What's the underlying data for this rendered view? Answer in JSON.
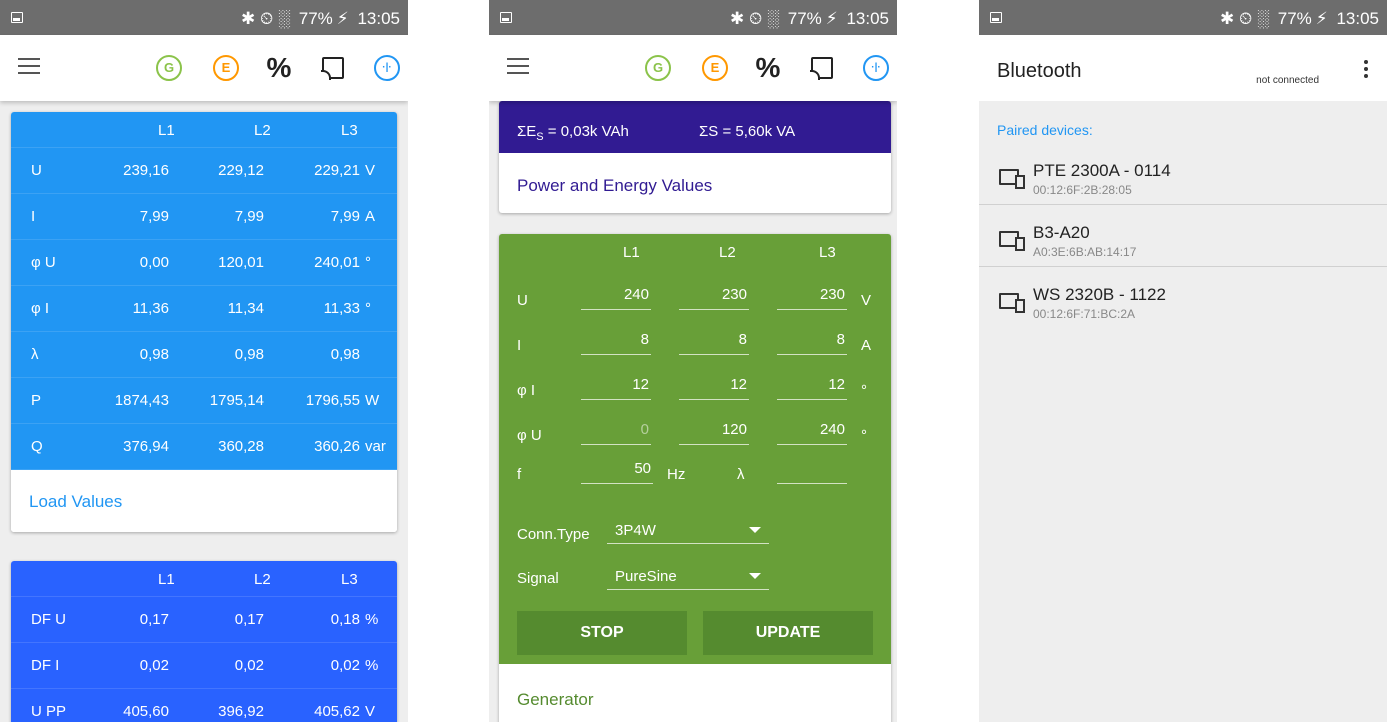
{
  "status_bar": {
    "icons": "✱ ⏲ ░",
    "battery": "77%",
    "battery_icon": "⚡",
    "time": "13:05"
  },
  "toolbar": {
    "icons": {
      "generator": "G",
      "energy": "E",
      "percent": "%",
      "cast": "cast-icon",
      "bluetooth": "·|·"
    }
  },
  "screen1": {
    "load": {
      "headers": [
        "L1",
        "L2",
        "L3"
      ],
      "rows": [
        {
          "name": "U",
          "v1": "239,16",
          "v2": "229,12",
          "v3": "229,21",
          "unit": "V"
        },
        {
          "name": "I",
          "v1": "7,99",
          "v2": "7,99",
          "v3": "7,99",
          "unit": "A"
        },
        {
          "name": "φ U",
          "v1": "0,00",
          "v2": "120,01",
          "v3": "240,01",
          "unit": "°"
        },
        {
          "name": "φ I",
          "v1": "11,36",
          "v2": "11,34",
          "v3": "11,33",
          "unit": "°"
        },
        {
          "name": "λ",
          "v1": "0,98",
          "v2": "0,98",
          "v3": "0,98",
          "unit": ""
        },
        {
          "name": "P",
          "v1": "1874,43",
          "v2": "1795,14",
          "v3": "1796,55",
          "unit": "W"
        },
        {
          "name": "Q",
          "v1": "376,94",
          "v2": "360,28",
          "v3": "360,26",
          "unit": "var"
        }
      ],
      "footer": "Load Values",
      "color": "#2196f3"
    },
    "harmonics": {
      "headers": [
        "L1",
        "L2",
        "L3"
      ],
      "rows": [
        {
          "name": "DF U",
          "v1": "0,17",
          "v2": "0,17",
          "v3": "0,18",
          "unit": "%"
        },
        {
          "name": "DF I",
          "v1": "0,02",
          "v2": "0,02",
          "v3": "0,02",
          "unit": "%"
        },
        {
          "name": "U PP",
          "v1": "405,60",
          "v2": "396,92",
          "v3": "405,62",
          "unit": "V"
        }
      ],
      "color": "#2962ff"
    }
  },
  "screen2": {
    "energy_es": "ΣE",
    "energy_es_sub": "S",
    "energy_es_value": " = 0,03k VAh",
    "power_s": "ΣS = 5,60k VA",
    "power_footer": "Power and Energy Values",
    "generator": {
      "headers": [
        "L1",
        "L2",
        "L3"
      ],
      "rows": [
        {
          "name": "U",
          "v1": "240",
          "v2": "230",
          "v3": "230",
          "unit": "V",
          "dim1": false
        },
        {
          "name": "I",
          "v1": "8",
          "v2": "8",
          "v3": "8",
          "unit": "A",
          "dim1": false
        },
        {
          "name": "φ I",
          "v1": "12",
          "v2": "12",
          "v3": "12",
          "unit": "°",
          "dim1": false
        },
        {
          "name": "φ U",
          "v1": "0",
          "v2": "120",
          "v3": "240",
          "unit": "°",
          "dim1": true
        }
      ],
      "f_label": "f",
      "f_value": "50",
      "f_unit": "Hz",
      "lambda_label": "λ",
      "lambda_value": "",
      "conn_label": "Conn.Type",
      "conn_value": "3P4W",
      "signal_label": "Signal",
      "signal_value": "PureSine",
      "stop_label": "STOP",
      "update_label": "UPDATE",
      "footer": "Generator"
    }
  },
  "screen3": {
    "title": "Bluetooth",
    "status": "not connected",
    "paired_label": "Paired devices:",
    "devices": [
      {
        "name": "PTE 2300A - 0114",
        "address": "00:12:6F:2B:28:05"
      },
      {
        "name": "B3-A20",
        "address": "A0:3E:6B:AB:14:17"
      },
      {
        "name": "WS 2320B - 1122",
        "address": "00:12:6F:71:BC:2A"
      }
    ]
  }
}
